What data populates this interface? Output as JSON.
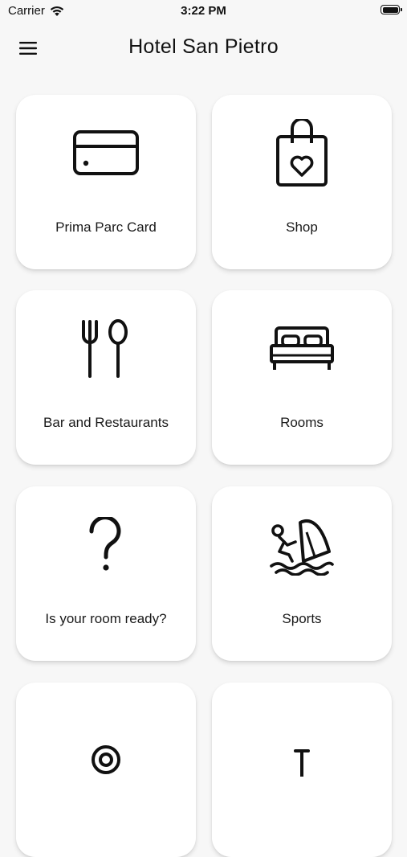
{
  "status_bar": {
    "carrier": "Carrier",
    "time": "3:22 PM",
    "battery_level": 1.0
  },
  "header": {
    "title": "Hotel San Pietro",
    "menu_icon": "hamburger-menu-icon"
  },
  "tiles": [
    {
      "label": "Prima Parc Card",
      "icon": "credit-card-icon"
    },
    {
      "label": "Shop",
      "icon": "shopping-bag-heart-icon"
    },
    {
      "label": "Bar and Restaurants",
      "icon": "fork-spoon-icon"
    },
    {
      "label": "Rooms",
      "icon": "bed-icon"
    },
    {
      "label": "Is your room ready?",
      "icon": "question-mark-icon"
    },
    {
      "label": "Sports",
      "icon": "windsurf-icon"
    },
    {
      "label": "",
      "icon": "target-icon"
    },
    {
      "label": "",
      "icon": "pin-icon"
    }
  ]
}
